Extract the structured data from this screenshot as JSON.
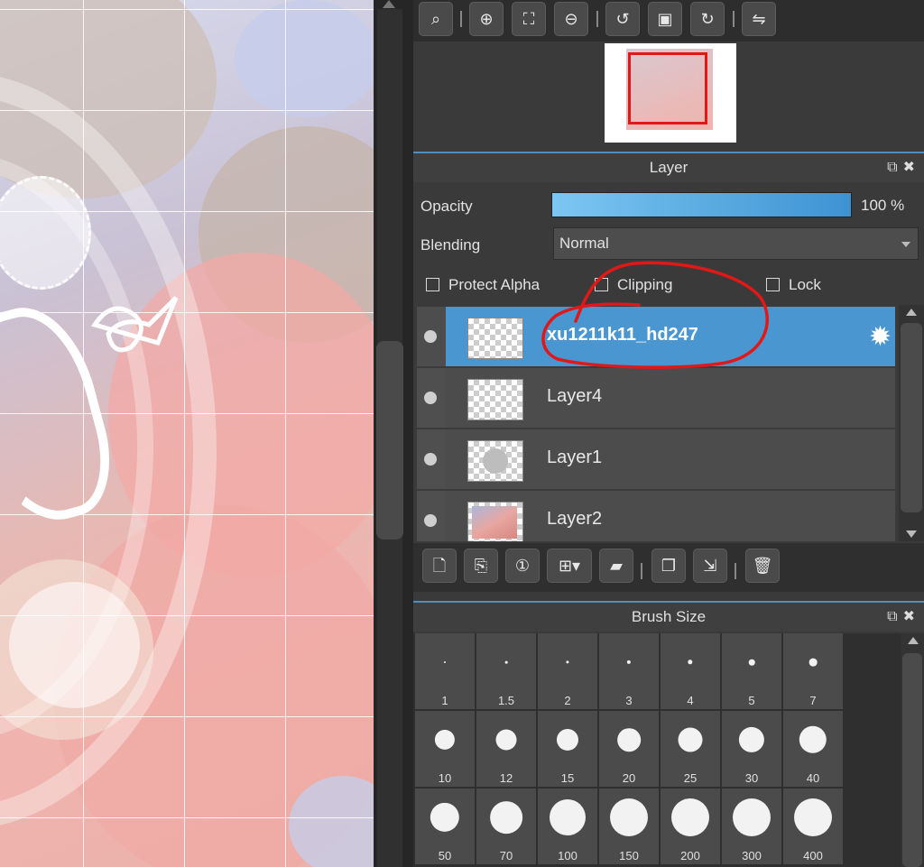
{
  "colors": {
    "accent": "#4a96d0",
    "opacity_bar": "#5aaee6",
    "annotation": "#e01818",
    "panel_bg": "#3a3a3a"
  },
  "toolbar": {
    "icons": [
      "zoom-actual-icon",
      "zoom-in-icon",
      "fit-screen-icon",
      "zoom-out-icon",
      "rotate-left-icon",
      "fullscreen-icon",
      "rotate-right-icon",
      "flip-horizontal-icon"
    ]
  },
  "layer_panel": {
    "title": "Layer",
    "opacity_label": "Opacity",
    "opacity_value": 100,
    "opacity_text": "100 %",
    "blending_label": "Blending",
    "blending_value": "Normal",
    "protect_alpha_label": "Protect Alpha",
    "clipping_label": "Clipping",
    "lock_label": "Lock",
    "layers": [
      {
        "name": "xu1211k11_hd247",
        "selected": true
      },
      {
        "name": "Layer4",
        "selected": false
      },
      {
        "name": "Layer1",
        "selected": false
      },
      {
        "name": "Layer2",
        "selected": false
      }
    ],
    "tool_icons": [
      "new-layer-icon",
      "new-layer-copy-icon",
      "layer-1bit-icon",
      "add-layer-menu-icon",
      "folder-icon",
      "duplicate-layer-icon",
      "merge-layer-icon",
      "delete-layer-icon"
    ]
  },
  "brush_panel": {
    "title": "Brush Size",
    "sizes": [
      "1",
      "1.5",
      "2",
      "3",
      "4",
      "5",
      "7",
      "10",
      "12",
      "15",
      "20",
      "25",
      "30",
      "40",
      "50",
      "70",
      "100",
      "150",
      "200",
      "300",
      "400"
    ]
  }
}
